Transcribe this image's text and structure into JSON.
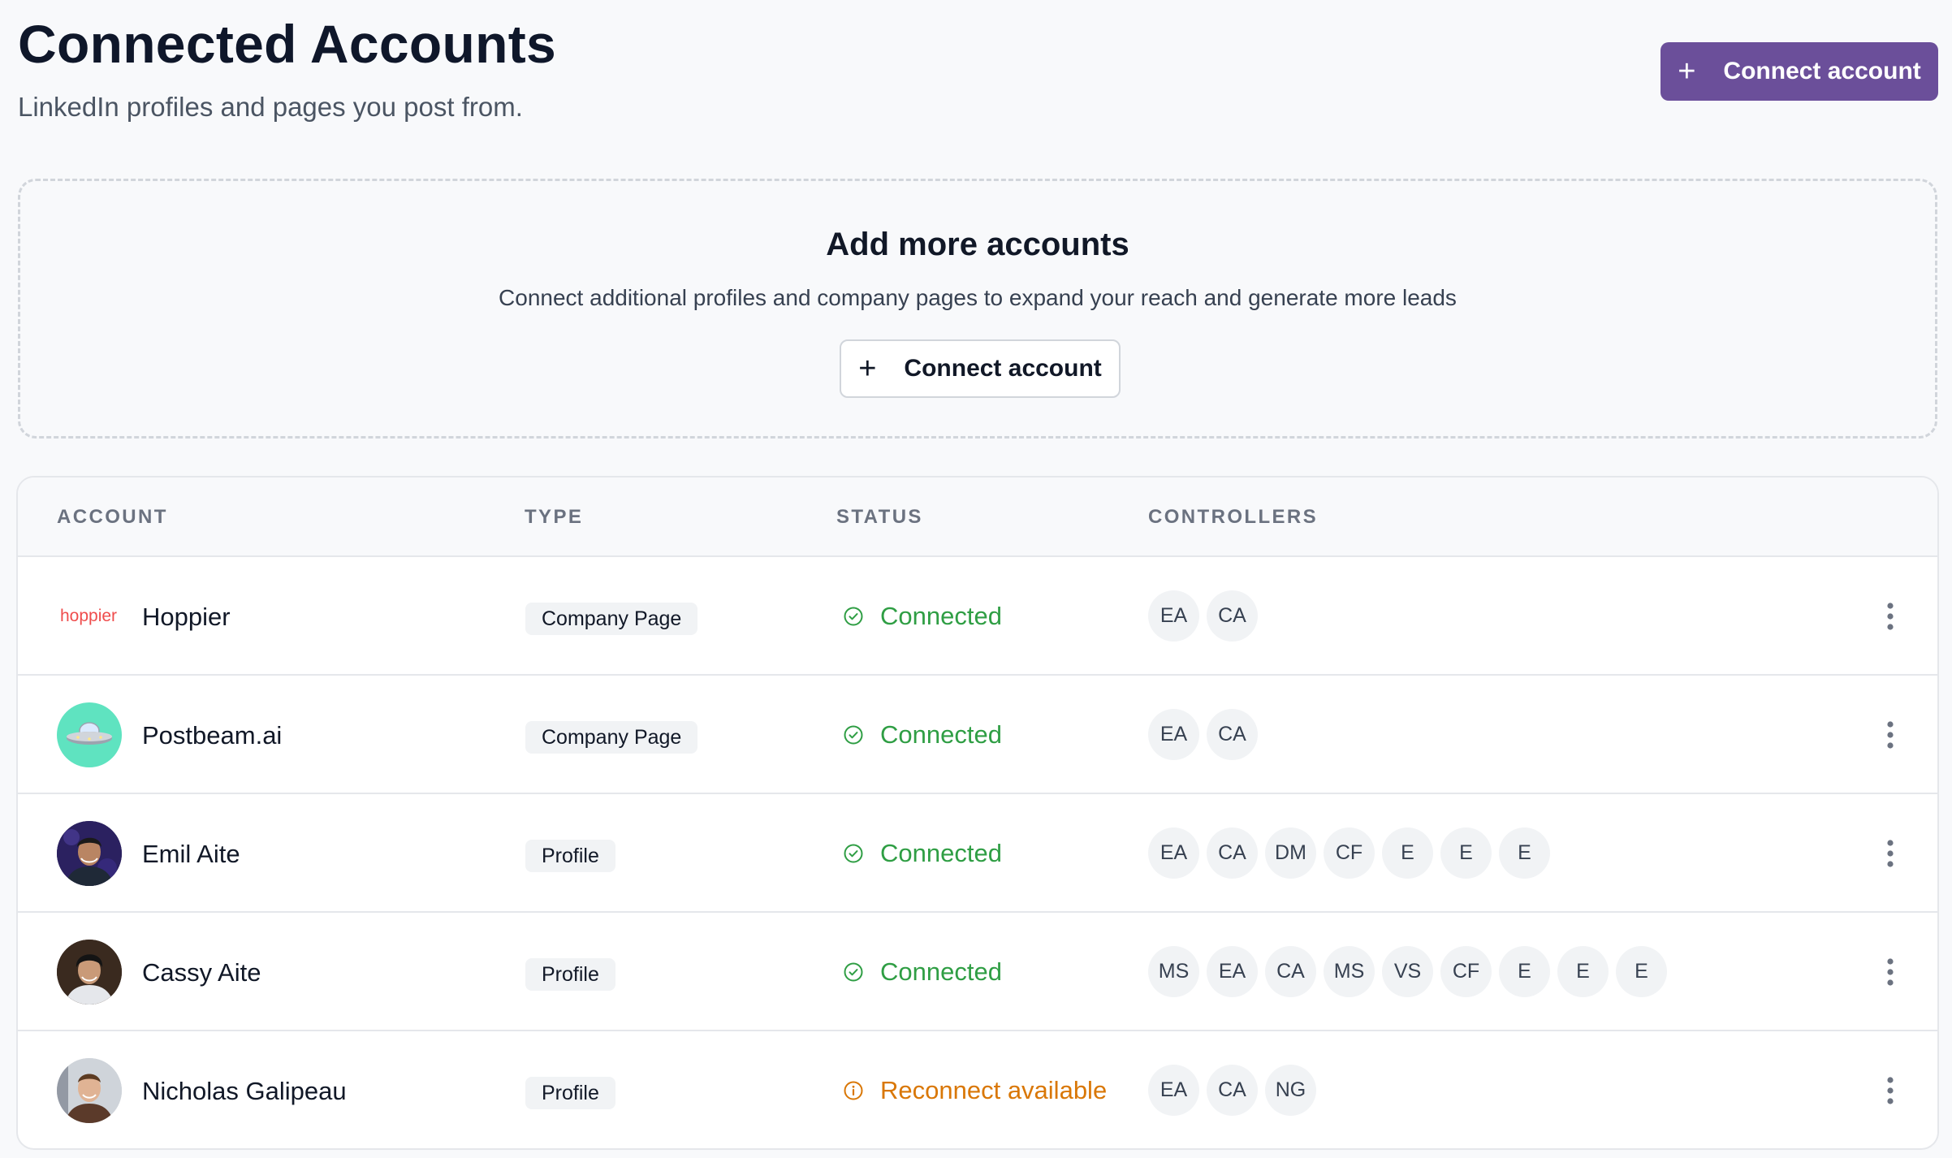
{
  "header": {
    "title": "Connected Accounts",
    "subtitle": "LinkedIn profiles and pages you post from.",
    "connect_button": "Connect account"
  },
  "add_box": {
    "title": "Add more accounts",
    "description": "Connect additional profiles and company pages to expand your reach and generate more leads",
    "connect_button": "Connect account"
  },
  "table": {
    "columns": [
      "ACCOUNT",
      "TYPE",
      "STATUS",
      "CONTROLLERS"
    ],
    "rows": [
      {
        "logo_text": "hoppier",
        "name": "Hoppier",
        "type": "Company Page",
        "status": "Connected",
        "status_kind": "connected",
        "controllers": [
          "EA",
          "CA"
        ]
      },
      {
        "name": "Postbeam.ai",
        "avatar_icon": "ufo-icon",
        "type": "Company Page",
        "status": "Connected",
        "status_kind": "connected",
        "controllers": [
          "EA",
          "CA"
        ]
      },
      {
        "name": "Emil Aite",
        "avatar_icon": "person-photo-icon",
        "type": "Profile",
        "status": "Connected",
        "status_kind": "connected",
        "controllers": [
          "EA",
          "CA",
          "DM",
          "CF",
          "E",
          "E",
          "E"
        ]
      },
      {
        "name": "Cassy Aite",
        "avatar_icon": "person-photo-icon",
        "type": "Profile",
        "status": "Connected",
        "status_kind": "connected",
        "controllers": [
          "MS",
          "EA",
          "CA",
          "MS",
          "VS",
          "CF",
          "E",
          "E",
          "E"
        ]
      },
      {
        "name": "Nicholas Galipeau",
        "avatar_icon": "person-photo-icon",
        "type": "Profile",
        "status": "Reconnect available",
        "status_kind": "warning",
        "controllers": [
          "EA",
          "CA",
          "NG"
        ]
      }
    ]
  },
  "colors": {
    "primary": "#6b4f9a",
    "connected": "#2f9e44",
    "warning": "#d97706",
    "hoppier_brand": "#ef4d4d",
    "postbeam_bg": "#5fe3c0"
  }
}
